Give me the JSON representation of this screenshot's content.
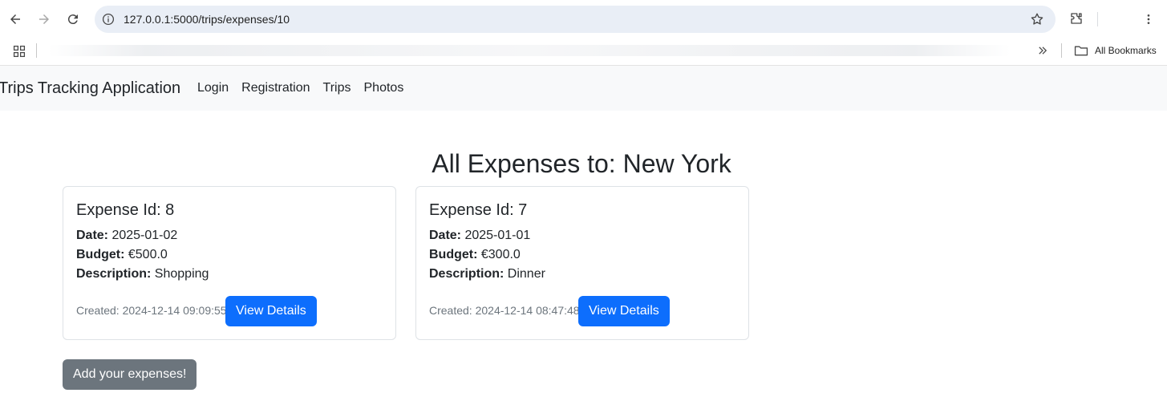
{
  "browser": {
    "url": "127.0.0.1:5000/trips/expenses/10",
    "bookmarks_label": "All Bookmarks"
  },
  "navbar": {
    "brand": "Trips Tracking Application",
    "links": [
      "Login",
      "Registration",
      "Trips",
      "Photos"
    ]
  },
  "page": {
    "title": "All Expenses to: New York",
    "add_button": "Add your expenses!"
  },
  "expense_labels": {
    "date": "Date:",
    "budget": "Budget:",
    "description": "Description:",
    "view_details": "View Details"
  },
  "expenses": [
    {
      "title": "Expense Id: 8",
      "date": "2025-01-02",
      "budget": "€500.0",
      "description": "Shopping",
      "created": "Created: 2024-12-14 09:09:55"
    },
    {
      "title": "Expense Id: 7",
      "date": "2025-01-01",
      "budget": "€300.0",
      "description": "Dinner",
      "created": "Created: 2024-12-14 08:47:48"
    }
  ],
  "colors": {
    "primary": "#0d6efd",
    "secondary": "#6c757d",
    "navbar_bg": "#f8f9fa",
    "omnibox_bg": "#e9eef6"
  }
}
